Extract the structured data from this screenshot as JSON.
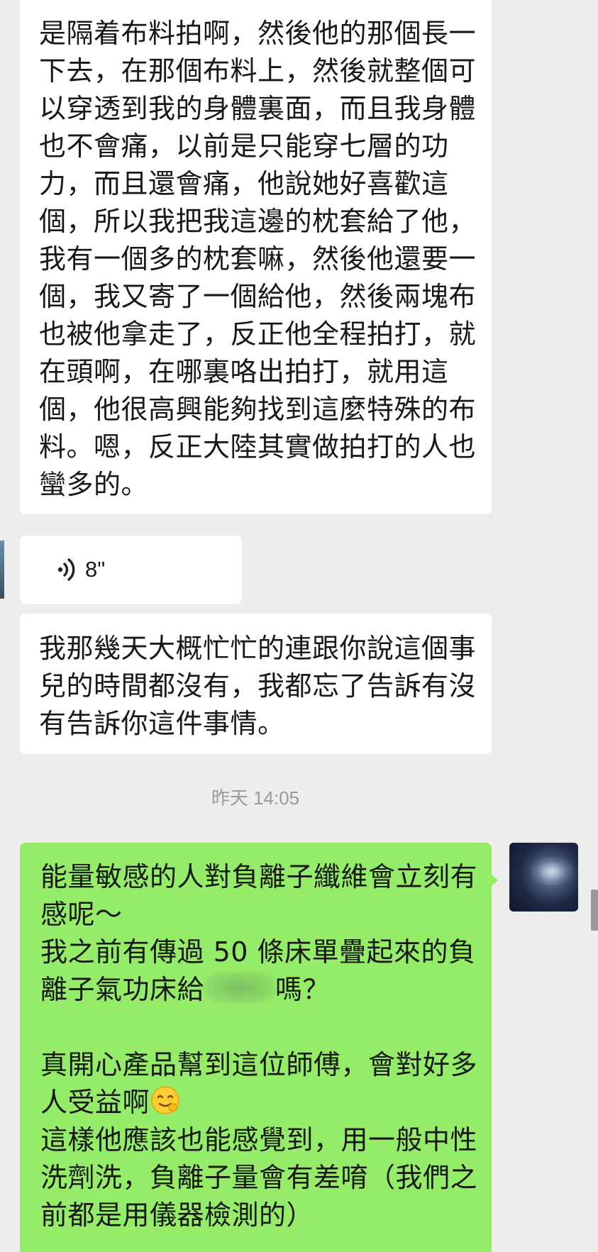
{
  "messages": {
    "msg1": {
      "text": "是隔着布料拍啊，然後他的那個長一下去，在那個布料上，然後就整個可以穿透到我的身體裏面，而且我身體也不會痛，以前是只能穿七層的功力，而且還會痛，他說她好喜歡這個，所以我把我這邊的枕套給了他，我有一個多的枕套嘛，然後他還要一個，我又寄了一個給他，然後兩塊布也被他拿走了，反正他全程拍打，就在頭啊，在哪裏咯出拍打，就用這個，他很高興能夠找到這麼特殊的布料。嗯，反正大陸其實做拍打的人也蠻多的。"
    },
    "voice": {
      "duration": "8\"",
      "icon": "voice-wave-icon"
    },
    "msg2": {
      "text": "我那幾天大概忙忙的連跟你說這個事兒的時間都沒有，我都忘了告訴有沒有告訴你這件事情。"
    },
    "timestamp": "昨天 14:05",
    "msg3": {
      "line1": "能量敏感的人對負離子纖維會立刻有感呢～",
      "line2a": "我之前有傳過 50 條床單疊起來的負離子氣功床給",
      "line2b": "嗎？",
      "line3": "真開心產品幫到這位師傅，會對好多人受益啊",
      "emoji": "smiling-face-emoji",
      "line4": "這樣他應該也能感覺到，用一般中性洗劑洗，負離子量會有差唷（我們之前都是用儀器檢測的）"
    }
  },
  "colors": {
    "background": "#ededed",
    "incoming_bubble": "#ffffff",
    "outgoing_bubble": "#95ec69",
    "timestamp": "#9b9b9b"
  }
}
